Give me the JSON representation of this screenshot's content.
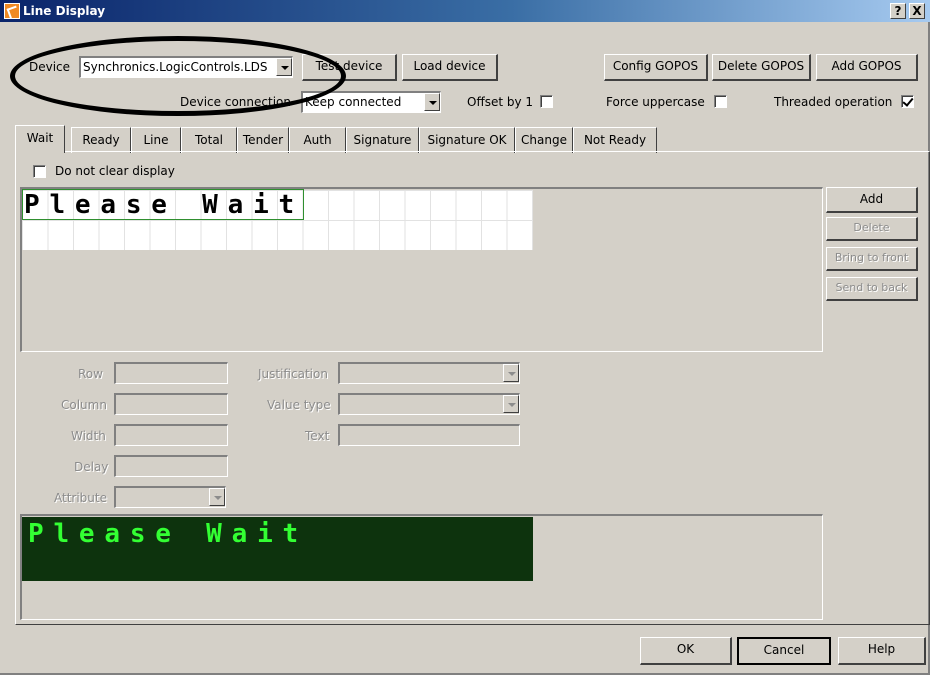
{
  "window": {
    "title": "Line Display"
  },
  "titlebar_buttons": {
    "help": "?",
    "close": "X"
  },
  "top": {
    "device_label": "Device",
    "device_value": "Synchronics.LogicControls.LDS",
    "test_device": "Test device",
    "load_device": "Load device",
    "config_gopos": "Config GOPOS",
    "delete_gopos": "Delete GOPOS",
    "add_gopos": "Add GOPOS",
    "device_connection_label": "Device connection",
    "device_connection_value": "Keep connected",
    "offset_label": "Offset by 1",
    "force_uppercase_label": "Force uppercase",
    "threaded_label": "Threaded operation",
    "offset_checked": false,
    "force_uppercase_checked": false,
    "threaded_checked": true
  },
  "tabs": [
    "Wait",
    "Ready",
    "Line",
    "Total",
    "Tender",
    "Auth",
    "Signature",
    "Signature OK",
    "Change",
    "Not Ready"
  ],
  "active_tab": "Wait",
  "panel": {
    "do_not_clear_label": "Do not clear display",
    "do_not_clear_checked": false,
    "display_text": "Please Wait",
    "side_buttons": {
      "add": "Add",
      "delete": "Delete",
      "bring_to_front": "Bring to front",
      "send_to_back": "Send to back"
    },
    "props": {
      "row": "Row",
      "column": "Column",
      "width": "Width",
      "delay": "Delay",
      "attribute": "Attribute",
      "justification": "Justification",
      "value_type": "Value type",
      "text": "Text"
    },
    "preview_text": "Please Wait"
  },
  "bottom": {
    "ok": "OK",
    "cancel": "Cancel",
    "help": "Help"
  },
  "colors": {
    "preview_bg": "#0d330d",
    "preview_text": "#33ff33",
    "selection_border": "#2f8f2f"
  }
}
